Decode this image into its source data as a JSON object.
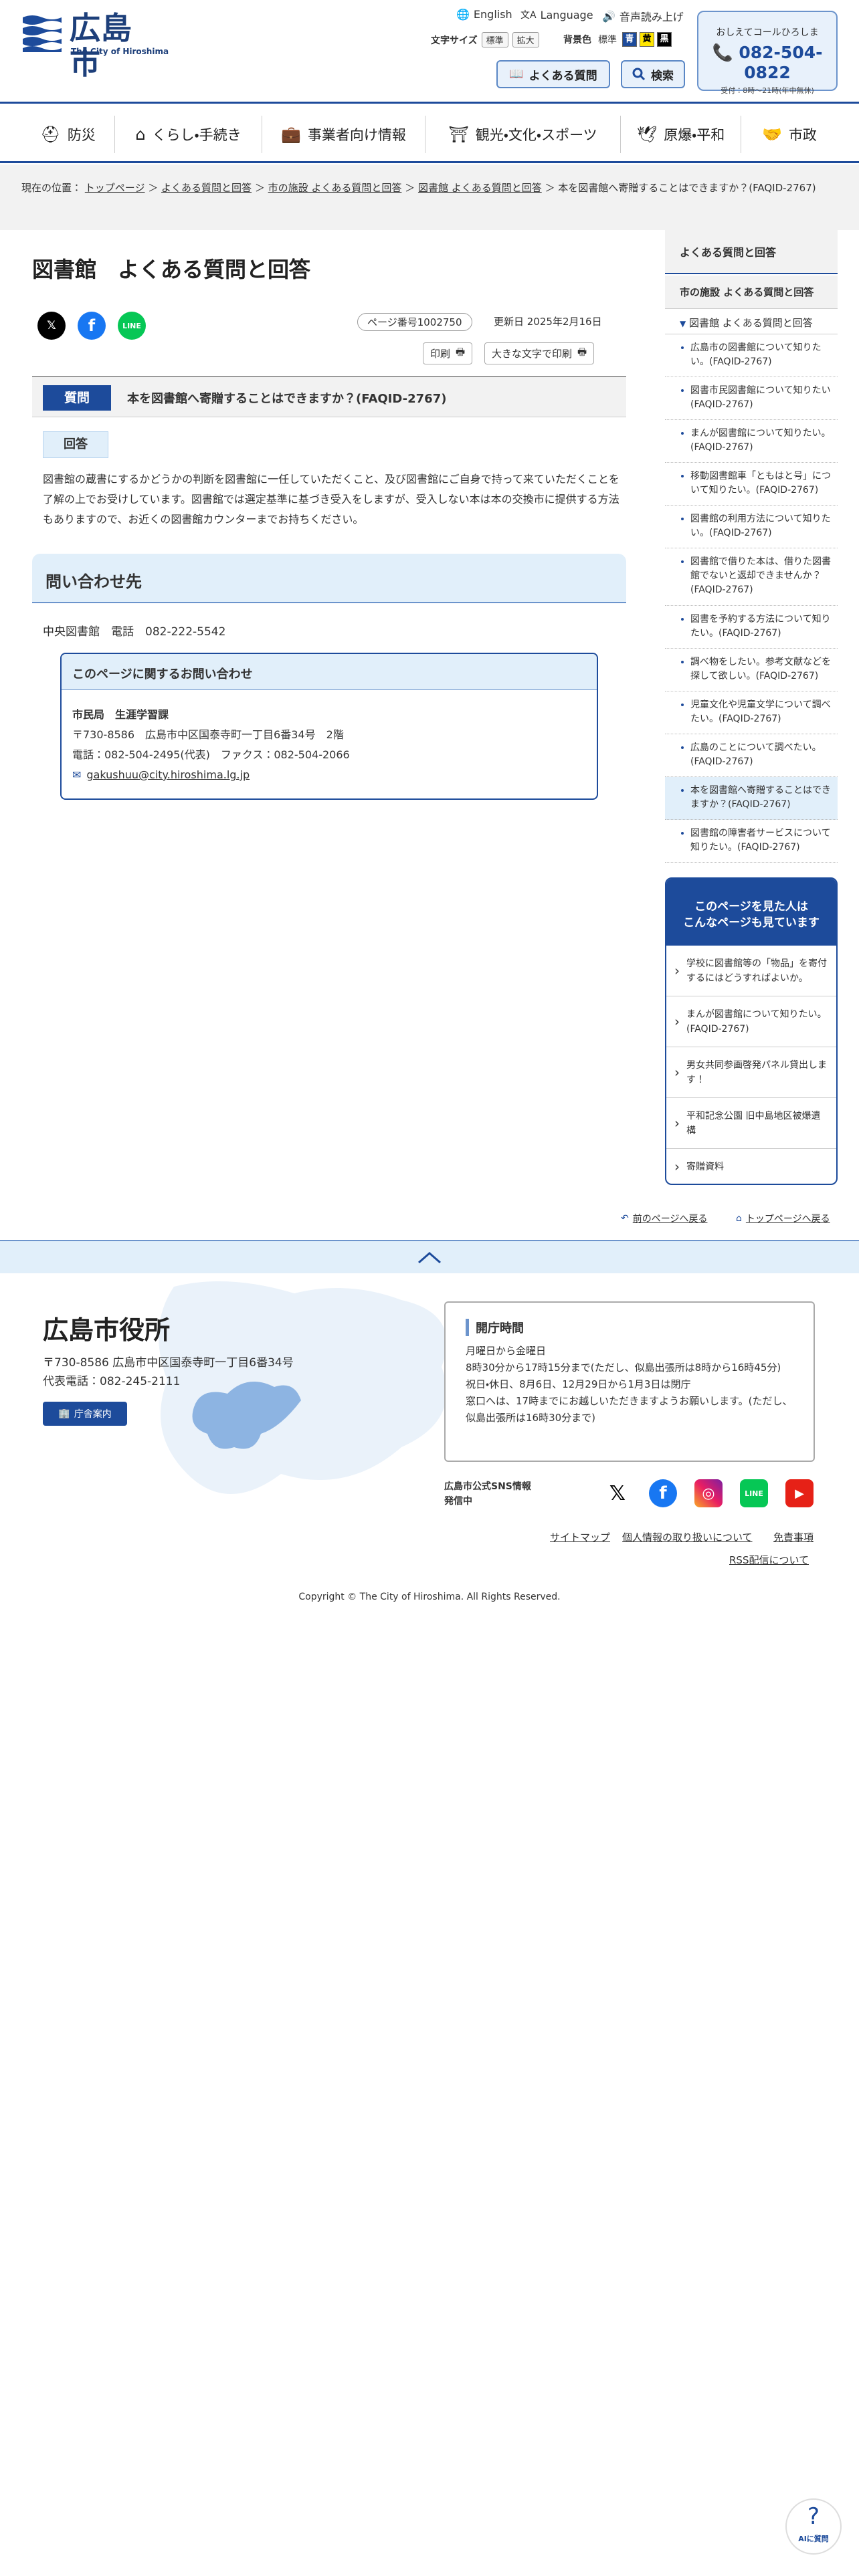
{
  "header": {
    "logo_title": "広島市",
    "logo_sub": "The City of Hiroshima",
    "english": "English",
    "language": "Language",
    "voice": "音声読み上げ",
    "font_size_label": "文字サイズ",
    "font_standard": "標準",
    "font_large": "拡大",
    "bg_label": "背景色",
    "bg_standard": "標準",
    "bg_blue": "青",
    "bg_yellow": "黄",
    "bg_black": "黒",
    "faq_btn": "よくある質問",
    "search_btn": "検索",
    "call_t1": "おしえてコールひろしま",
    "call_phone": "082-504-0822",
    "call_hours": "受付：8時～21時(年中無休)"
  },
  "nav": [
    {
      "label": "防災",
      "icon": "disaster-prevention-icon"
    },
    {
      "label": "くらし・手続き",
      "icon": "house-icon"
    },
    {
      "label": "事業者向け情報",
      "icon": "briefcase-icon"
    },
    {
      "label": "観光・文化・スポーツ",
      "icon": "tourism-icon"
    },
    {
      "label": "原爆・平和",
      "icon": "dove-icon"
    },
    {
      "label": "市政",
      "icon": "handshake-icon"
    }
  ],
  "breadcrumb": {
    "prefix": "現在の位置：",
    "items": [
      "トップページ",
      "よくある質問と回答",
      "市の施設 よくある質問と回答",
      "図書館 よくある質問と回答"
    ],
    "current": "本を図書館へ寄贈することはできますか？(FAQID-2767)"
  },
  "main": {
    "title": "図書館　よくある質問と回答",
    "page_number": "ページ番号1002750",
    "updated": "更新日 2025年2月16日",
    "print": "印刷",
    "print_large": "大きな文字で印刷",
    "question_label": "質問",
    "question_text": "本を図書館へ寄贈することはできますか？(FAQID-2767)",
    "answer_label": "回答",
    "answer_text": "図書館の蔵書にするかどうかの判断を図書館に一任していただくこと、及び図書館にご自身で持って来ていただくことを了解の上でお受けしています。図書館では選定基準に基づき受入をしますが、受入しない本は本の交換市に提供する方法もありますので、お近くの図書館カウンターまでお持ちください。",
    "contact_heading": "問い合わせ先",
    "contact_line": "中央図書館　電話　082-222-5542",
    "inquiry_heading": "このページに関するお問い合わせ",
    "inq_dept": "市民局　生涯学習課",
    "inq_addr": "〒730-8586　広島市中区国泰寺町一丁目6番34号　2階",
    "inq_tel": "電話：082-504-2495(代表)　ファクス：082-504-2066",
    "inq_mail": "gakushuu@city.hiroshima.lg.jp"
  },
  "sidebar": {
    "heading": "よくある質問と回答",
    "sub": "市の施設 よくある質問と回答",
    "sub2": "図書館 よくある質問と回答",
    "items": [
      "広島市の図書館について知りたい。(FAQID-2767)",
      "図書市民図書館について知りたい(FAQID-2767)",
      "まんが図書館について知りたい。(FAQID-2767)",
      "移動図書館車「ともはと号」について知りたい。(FAQID-2767)",
      "図書館の利用方法について知りたい。(FAQID-2767)",
      "図書館で借りた本は、借りた図書館でないと返却できませんか？(FAQID-2767)",
      "図書を予約する方法について知りたい。(FAQID-2767)",
      "調べ物をしたい。参考文献などを探して欲しい。(FAQID-2767)",
      "児童文化や児童文学について調べたい。(FAQID-2767)",
      "広島のことについて調べたい。(FAQID-2767)",
      "本を図書館へ寄贈することはできますか？(FAQID-2767)",
      "図書館の障害者サービスについて知りたい。(FAQID-2767)"
    ],
    "also_heading_1": "このページを見た人は",
    "also_heading_2": "こんなページも見ています",
    "also_items": [
      "学校に図書館等の「物品」を寄付するにはどうすればよいか。",
      "まんが図書館について知りたい。(FAQID-2767)",
      "男女共同参画啓発パネル貸出します！",
      "平和記念公園 旧中島地区被爆遺構",
      "寄贈資料"
    ]
  },
  "backlinks": {
    "prev": "前のページへ戻る",
    "top": "トップページへ戻る"
  },
  "footer": {
    "name": "広島市役所",
    "addr": "〒730-8586 広島市中区国泰寺町一丁目6番34号",
    "tel": "代表電話：082-245-2111",
    "guide_btn": "庁舎案内",
    "hours_heading": "開庁時間",
    "hours_body_1": "月曜日から金曜日",
    "hours_body_2": "8時30分から17時15分まで(ただし、似島出張所は8時から16時45分)",
    "hours_body_3": "祝日・休日、8月6日、12月29日から1月3日は閉庁",
    "hours_body_4": "窓口へは、17時までにお越しいただきますようお願いします。(ただし、似島出張所は16時30分まで)",
    "sns_label": "広島市公式SNS情報発信中",
    "links": [
      "サイトマップ",
      "個人情報の取り扱いについて",
      "免責事項",
      "RSS配信について"
    ],
    "copyright": "Copyright © The City of Hiroshima. All Rights Reserved."
  },
  "ai_button": "AIに質問",
  "colors": {
    "brand": "#1d4b9b",
    "light": "#e1effa"
  }
}
